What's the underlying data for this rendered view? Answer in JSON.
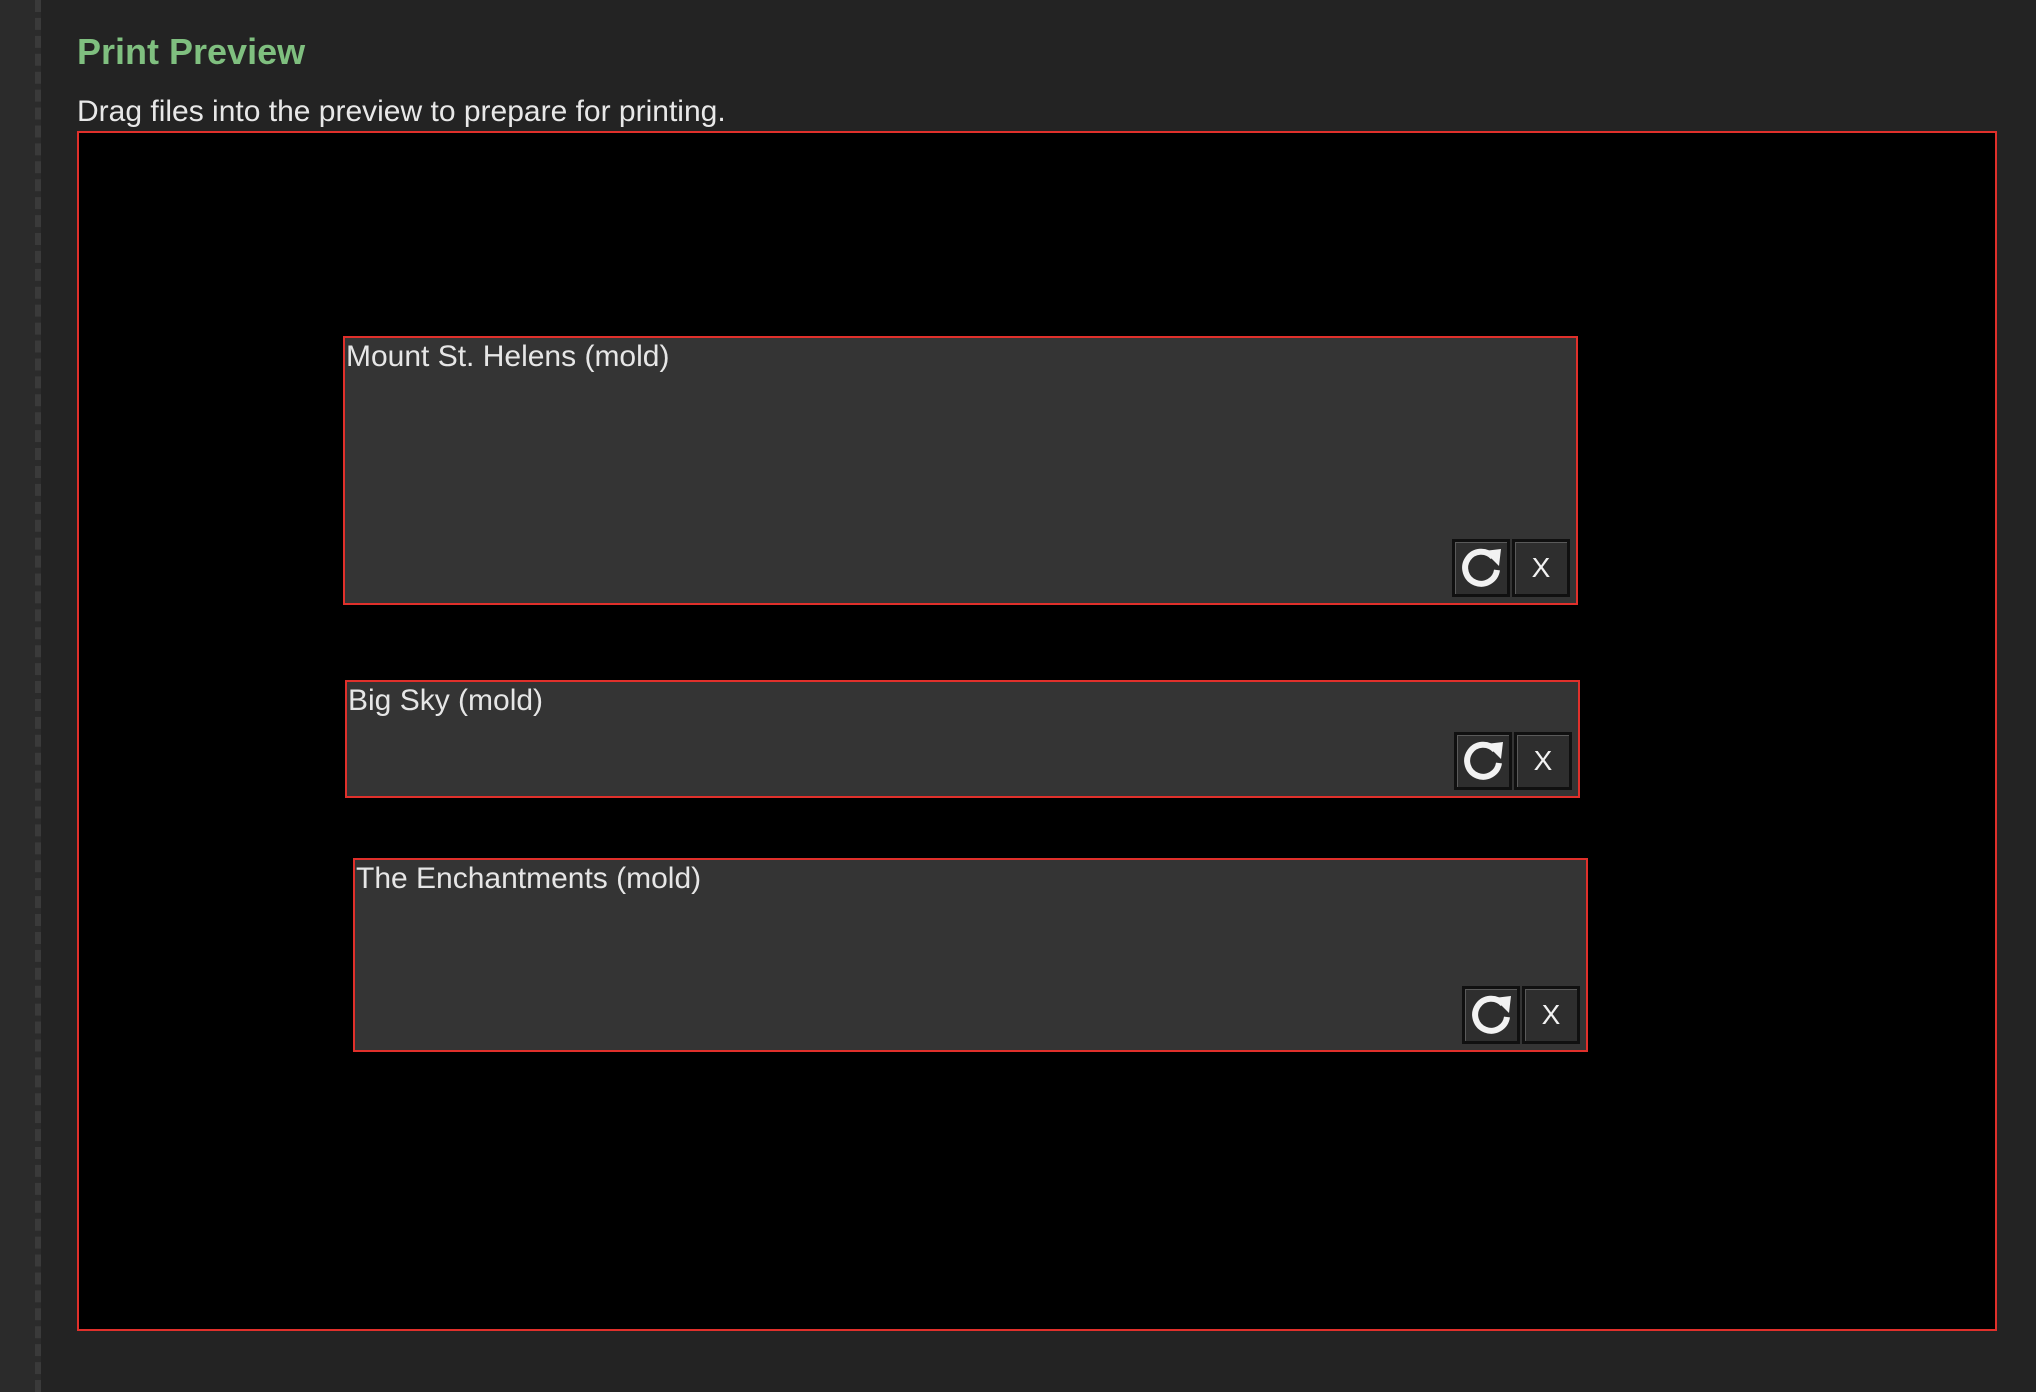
{
  "header": {
    "title": "Print Preview",
    "subtitle": "Drag files into the preview to prepare for printing."
  },
  "colors": {
    "accent_title": "#7fbf7f",
    "border": "#e0302b",
    "background": "#232323",
    "preview_background": "#000000",
    "card_background": "#343434"
  },
  "cards": [
    {
      "title": "Mount St. Helens (mold)",
      "rotate_icon": "rotate-clockwise-icon",
      "close_label": "X"
    },
    {
      "title": "Big Sky (mold)",
      "rotate_icon": "rotate-clockwise-icon",
      "close_label": "X"
    },
    {
      "title": "The Enchantments (mold)",
      "rotate_icon": "rotate-clockwise-icon",
      "close_label": "X"
    }
  ]
}
